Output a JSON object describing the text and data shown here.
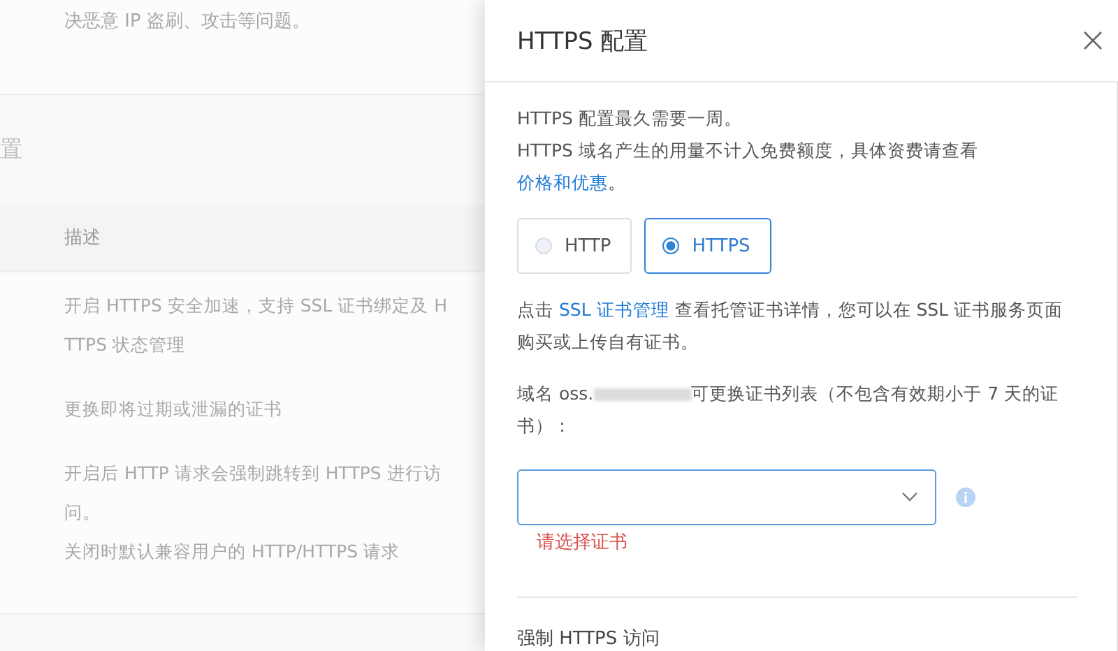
{
  "background": {
    "intro_text": "决恶意 IP 盗刷、攻击等问题。",
    "section_title": "置",
    "table": {
      "column_header": "描述",
      "rows": [
        {
          "lines": [
            "开启 HTTPS 安全加速，支持 SSL 证书绑定及 H",
            "TTPS 状态管理"
          ]
        },
        {
          "lines": [
            "更换即将过期或泄漏的证书"
          ]
        },
        {
          "lines": [
            "开启后 HTTP 请求会强制跳转到 HTTPS 进行访",
            "问。",
            "关闭时默认兼容用户的 HTTP/HTTPS 请求"
          ]
        }
      ]
    }
  },
  "drawer": {
    "title": "HTTPS 配置",
    "notice_lines": [
      {
        "text": "HTTPS 配置最久需要一周。"
      },
      {
        "text": "HTTPS 域名产生的用量不计入免费额度，具体资费请查看",
        "link": "价格和优惠",
        "after": "。"
      }
    ],
    "protocol_options": [
      {
        "label": "HTTP",
        "selected": false
      },
      {
        "label": "HTTPS",
        "selected": true
      }
    ],
    "cert_hint": {
      "text": "点击 ",
      "link": "SSL 证书管理",
      "after": " 查看托管证书详情，您可以在 SSL 证书服务页面购买或上传自有证书。"
    },
    "domain_label_prefix": "域名 oss.",
    "domain_label_suffix": "可更换证书列表（不包含有效期小于 7 天的证书）：",
    "cert_select": {
      "error": "请选择证书"
    },
    "next_section": "强制 HTTPS 访问"
  }
}
